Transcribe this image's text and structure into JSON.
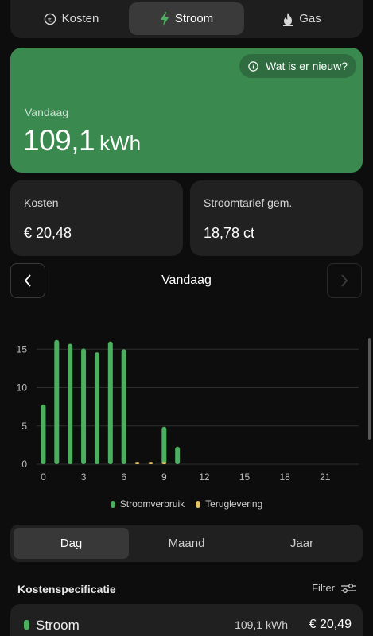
{
  "tabs": [
    {
      "label": "Kosten",
      "icon": "euro-icon"
    },
    {
      "label": "Stroom",
      "icon": "lightning-icon"
    },
    {
      "label": "Gas",
      "icon": "flame-icon"
    }
  ],
  "active_tab": "Stroom",
  "hero": {
    "whats_new": "Wat is er nieuw?",
    "label": "Vandaag",
    "value": "109,1",
    "unit": "kWh"
  },
  "stats": {
    "costs_label": "Kosten",
    "costs_value": "€ 20,48",
    "tariff_label": "Stroomtarief gem.",
    "tariff_value": "18,78 ct"
  },
  "period": {
    "title": "Vandaag"
  },
  "chart_data": {
    "type": "bar",
    "x_ticks": [
      0,
      3,
      6,
      9,
      12,
      15,
      18,
      21
    ],
    "y_ticks": [
      0,
      5,
      10,
      15
    ],
    "ylim": [
      0,
      17
    ],
    "xlim": [
      -0.5,
      23.5
    ],
    "grid": true,
    "legend_position": "bottom",
    "series": [
      {
        "name": "Stroomverbruik",
        "color": "#4caf5f",
        "x": [
          0,
          1,
          2,
          3,
          4,
          5,
          6,
          9,
          10
        ],
        "values": [
          7.8,
          16.2,
          15.7,
          15.1,
          14.6,
          16.0,
          15.0,
          4.9,
          2.3
        ]
      },
      {
        "name": "Teruglevering",
        "color": "#e3c36a",
        "x": [
          7,
          8,
          9
        ],
        "values": [
          0.3,
          0.3,
          0.3
        ]
      }
    ]
  },
  "segments": [
    "Dag",
    "Maand",
    "Jaar"
  ],
  "active_segment": "Dag",
  "spec": {
    "title": "Kostenspecificatie",
    "filter_label": "Filter"
  },
  "rows": [
    {
      "label": "Stroom",
      "kwh": "109,1 kWh",
      "eur": "€ 20,49"
    }
  ]
}
